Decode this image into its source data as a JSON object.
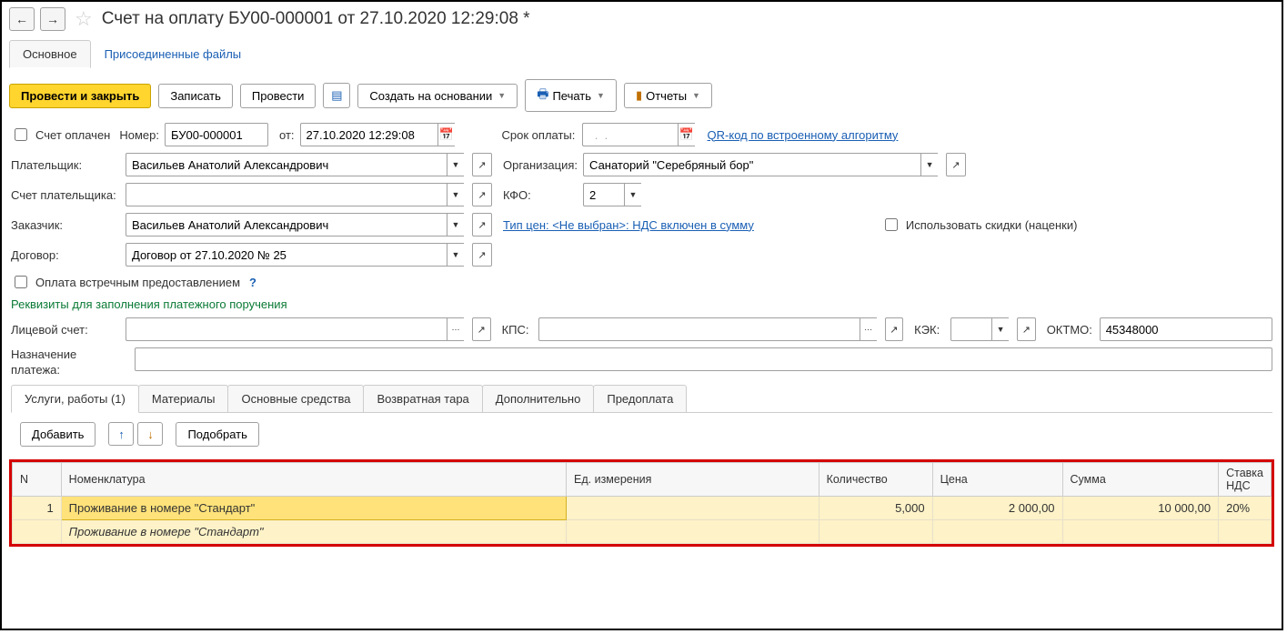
{
  "title": "Счет на оплату БУ00-000001 от 27.10.2020 12:29:08 *",
  "topTabs": {
    "main": "Основное",
    "files": "Присоединенные файлы"
  },
  "toolbar": {
    "postClose": "Провести и закрыть",
    "save": "Записать",
    "post": "Провести",
    "createBased": "Создать на основании",
    "print": "Печать",
    "reports": "Отчеты"
  },
  "fields": {
    "paidLabel": "Счет оплачен",
    "numberLabel": "Номер:",
    "number": "БУ00-000001",
    "fromLabel": "от:",
    "date": "27.10.2020 12:29:08",
    "dueLabel": "Срок оплаты:",
    "due": "  .  .    ",
    "qrLink": "QR-код по встроенному алгоритму",
    "payerLabel": "Плательщик:",
    "payer": "Васильев Анатолий Александрович",
    "orgLabel": "Организация:",
    "org": "Санаторий \"Серебряный бор\"",
    "payerAccLabel": "Счет плательщика:",
    "kfoLabel": "КФО:",
    "kfo": "2",
    "customerLabel": "Заказчик:",
    "customer": "Васильев Анатолий Александрович",
    "priceTypeLink": "Тип цен: <Не выбран>: НДС включен в сумму",
    "discountsLabel": "Использовать скидки (наценки)",
    "contractLabel": "Договор:",
    "contract": "Договор от 27.10.2020 № 25",
    "counterLabel": "Оплата встречным предоставлением",
    "paymentDetailsLink": "Реквизиты для заполнения платежного поручения",
    "persAccLabel": "Лицевой счет:",
    "kpsLabel": "КПС:",
    "kekLabel": "КЭК:",
    "oktmoLabel": "ОКТМО:",
    "oktmo": "45348000",
    "purposeLabel": "Назначение платежа:"
  },
  "mainTabs": {
    "services": "Услуги, работы (1)",
    "materials": "Материалы",
    "fixed": "Основные средства",
    "returnable": "Возвратная тара",
    "additional": "Дополнительно",
    "prepay": "Предоплата"
  },
  "gridToolbar": {
    "add": "Добавить",
    "pick": "Подобрать"
  },
  "gridHeaders": {
    "n": "N",
    "nom": "Номенклатура",
    "unit": "Ед. измерения",
    "qty": "Количество",
    "price": "Цена",
    "sum": "Сумма",
    "vat": "Ставка НДС"
  },
  "gridRows": [
    {
      "n": "1",
      "nom": "Проживание в номере \"Стандарт\"",
      "unit": "",
      "qty": "5,000",
      "price": "2 000,00",
      "sum": "10 000,00",
      "vat": "20%",
      "desc": "Проживание в номере \"Стандарт\""
    }
  ]
}
